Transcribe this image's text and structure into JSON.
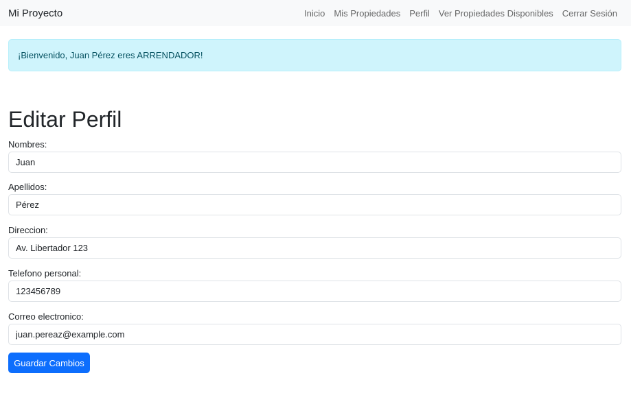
{
  "navbar": {
    "brand": "Mi Proyecto",
    "links": [
      "Inicio",
      "Mis Propiedades",
      "Perfil",
      "Ver Propiedades Disponibles",
      "Cerrar Sesión"
    ]
  },
  "alert": {
    "text": "¡Bienvenido, Juan Pérez eres ARRENDADOR!"
  },
  "page": {
    "title": "Editar Perfil"
  },
  "form": {
    "fields": [
      {
        "label": "Nombres:",
        "value": "Juan"
      },
      {
        "label": "Apellidos:",
        "value": "Pérez"
      },
      {
        "label": "Direccion:",
        "value": "Av. Libertador 123"
      },
      {
        "label": "Telefono personal:",
        "value": "123456789"
      },
      {
        "label": "Correo electronico:",
        "value": "juan.pereaz@example.com"
      }
    ],
    "submit_label": "Guardar Cambios"
  },
  "colors": {
    "primary": "#0d6efd",
    "alert_bg": "#cff4fc",
    "navbar_bg": "#f8f9fa"
  }
}
